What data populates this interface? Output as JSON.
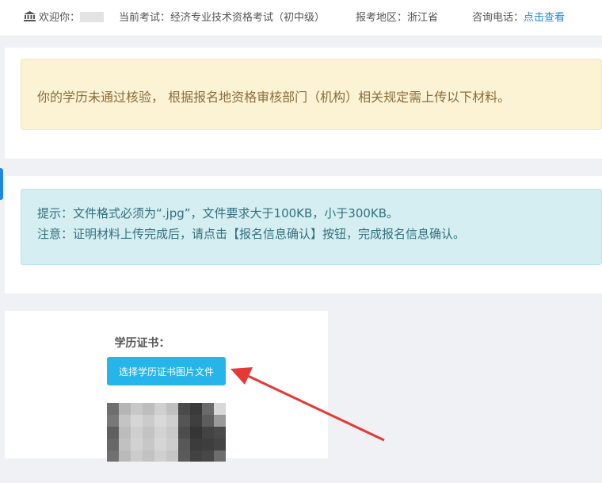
{
  "header": {
    "welcome_label": "欢迎你：",
    "current_exam": "当前考试：经济专业技术资格考试（初中级）",
    "region": "报考地区：浙江省",
    "phone_label": "咨询电话：",
    "phone_link": "点击查看"
  },
  "warning": {
    "message": "你的学历未通过核验， 根据报名地资格审核部门（机构）相关规定需上传以下材料。"
  },
  "info": {
    "tip": "提示：文件格式必须为“.jpg”，文件要求大于100KB，小于300KB。",
    "note": "注意：证明材料上传完成后，请点击【报名信息确认】按钮，完成报名信息确认。"
  },
  "upload": {
    "title": "学历证书：",
    "button_label": "选择学历证书图片文件"
  },
  "colors": {
    "accent": "#25b5e8",
    "link": "#1f8ad8",
    "warning_bg": "#fcf3d4",
    "warning_text": "#8a6d3b",
    "info_bg": "#d5eef2",
    "info_text": "#33707c",
    "annotation_arrow": "#e53935"
  },
  "icons": {
    "home": "bank-building-icon",
    "annotation": "red-arrow-icon"
  }
}
